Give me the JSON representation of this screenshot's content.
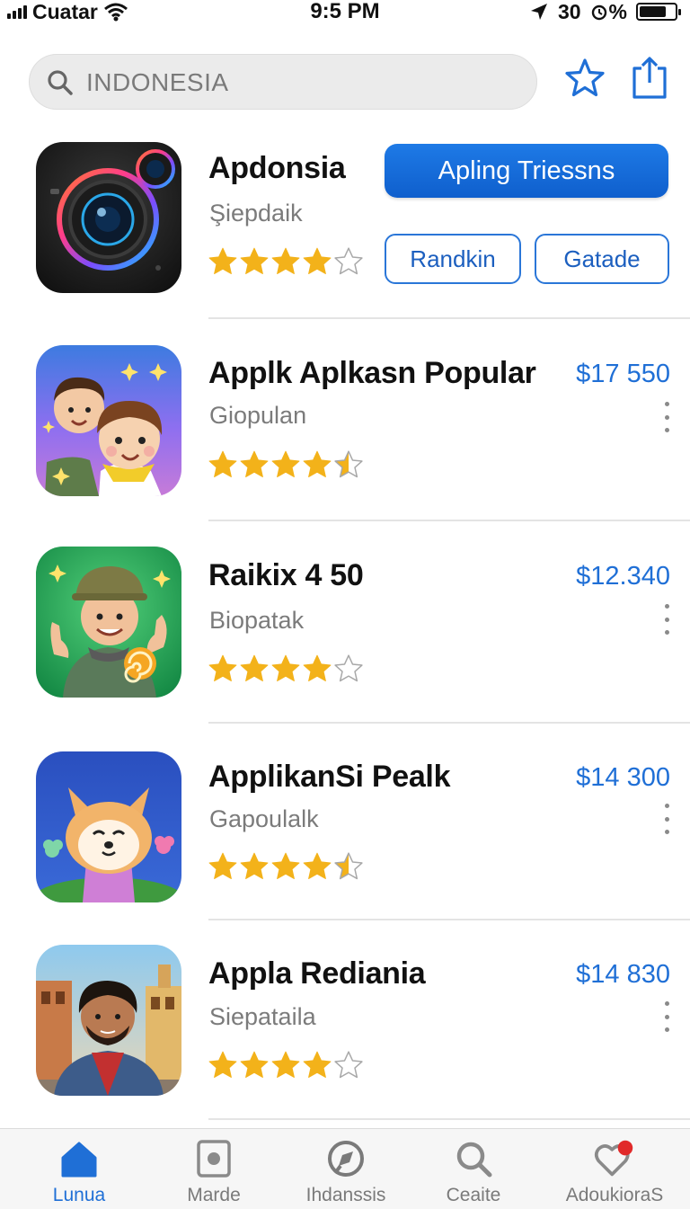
{
  "status_bar": {
    "carrier": "Cuatar",
    "time": "9:5 PM",
    "location_value": "30",
    "battery_text": "%",
    "battery_level": 0.8
  },
  "search": {
    "value": "INDONESIA",
    "placeholder": "INDONESIA"
  },
  "featured": {
    "name": "Apdonsia",
    "subtitle": "Şiepdaik",
    "rating": 4,
    "primary_button": "Apling Triessns",
    "secondary_buttons": [
      "Randkin",
      "Gatade"
    ]
  },
  "apps": [
    {
      "name": "Applk Aplkasn Popular",
      "subtitle": "Giopulan",
      "price": "$17 550",
      "rating": 4.5
    },
    {
      "name": "Raikix 4 50",
      "subtitle": "Biopatak",
      "price": "$12.340",
      "rating": 4
    },
    {
      "name": "ApplikanSi Pealk",
      "subtitle": "Gapoulalk",
      "price": "$14 300",
      "rating": 4.5
    },
    {
      "name": "Appla Rediania",
      "subtitle": "Siepataila",
      "price": "$14 830",
      "rating": 4
    }
  ],
  "tabs": [
    {
      "label": "Lunua",
      "icon": "home-icon",
      "active": true
    },
    {
      "label": "Marde",
      "icon": "photo-icon",
      "active": false
    },
    {
      "label": "Ihdanssis",
      "icon": "compass-icon",
      "active": false
    },
    {
      "label": "Ceaite",
      "icon": "search-icon",
      "active": false
    },
    {
      "label": "AdoukioraS",
      "icon": "heart-badge-icon",
      "active": false
    }
  ],
  "colors": {
    "accent": "#1f6fd6",
    "star": "#f3b21a",
    "badge": "#e12a2a"
  }
}
